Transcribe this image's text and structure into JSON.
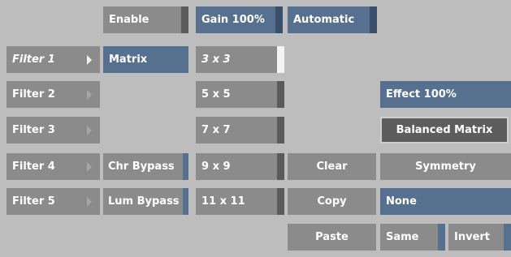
{
  "top_row": {
    "enable": "Enable",
    "gain": "Gain 100%",
    "automatic": "Automatic"
  },
  "filters": [
    {
      "label": "Filter 1",
      "active": true
    },
    {
      "label": "Filter 2",
      "active": false
    },
    {
      "label": "Filter 3",
      "active": false
    },
    {
      "label": "Filter 4",
      "active": false
    },
    {
      "label": "Filter 5",
      "active": false
    }
  ],
  "matrix_label": "Matrix",
  "bypass": {
    "chroma": "Chr Bypass",
    "luma": "Lum Bypass"
  },
  "kernel_sizes": [
    "3 x 3",
    "5 x 5",
    "7 x 7",
    "9 x 9",
    "11 x 11"
  ],
  "kernel_selected": "3 x 3",
  "actions": {
    "clear": "Clear",
    "copy": "Copy",
    "paste": "Paste"
  },
  "effect": "Effect 100%",
  "balanced_matrix": "Balanced Matrix",
  "symmetry": "Symmetry",
  "symmetry_value": "None",
  "same": "Same",
  "invert": "Invert",
  "colors": {
    "background": "#bdbdbd",
    "button": "#8b8b8b",
    "active": "#58708f",
    "dark": "#5d5d5d"
  }
}
